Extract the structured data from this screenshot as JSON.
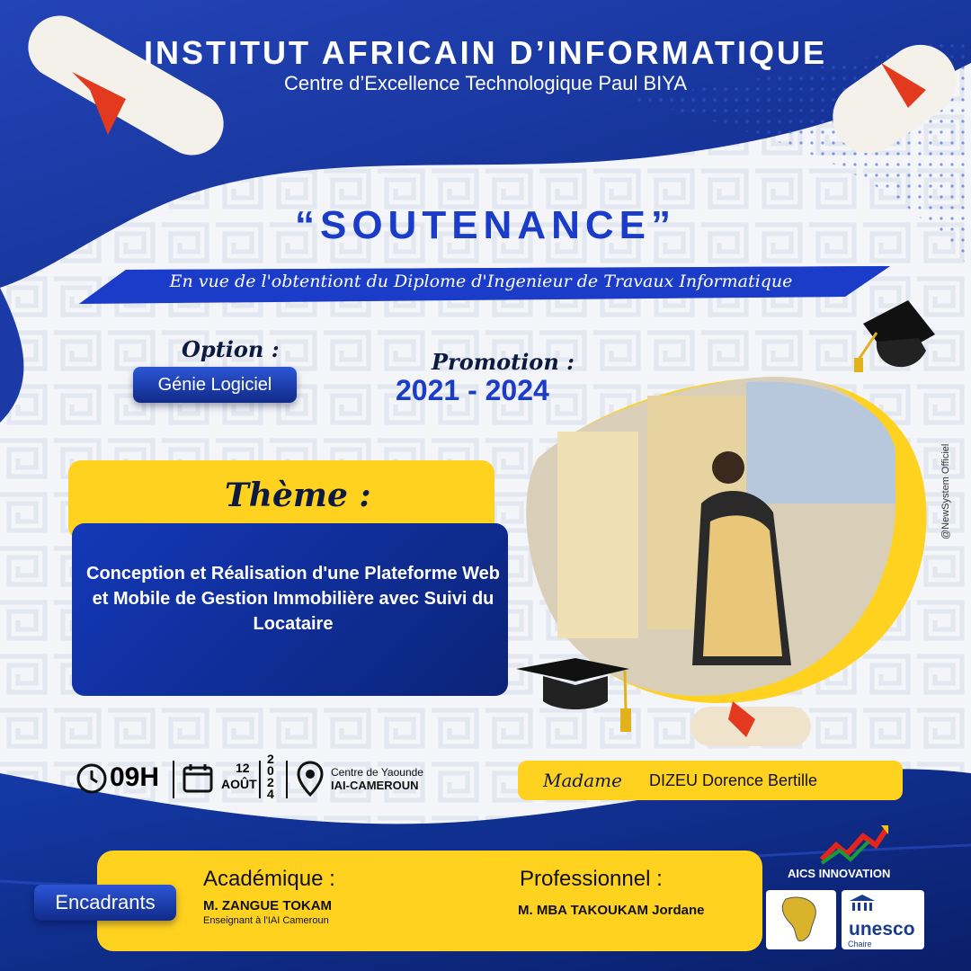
{
  "header": {
    "institute": "INSTITUT AFRICAIN D’INFORMATIQUE",
    "subtitle": "Centre d’Excellence Technologique Paul BIYA"
  },
  "event": {
    "title": "“SOUTENANCE”",
    "purpose": "En vue de l'obtentiont du Diplome d'Ingenieur de Travaux Informatique"
  },
  "option": {
    "label": "Option :",
    "value": "Génie Logiciel"
  },
  "promotion": {
    "label": "Promotion :",
    "years": "2021 - 2024"
  },
  "theme": {
    "label": "Thème :",
    "text": "Conception et Réalisation d'une Plateforme Web et Mobile de Gestion Immobilière avec Suivi du Locataire"
  },
  "schedule": {
    "time": "09H",
    "day": "12",
    "month": "AOÛT",
    "year": "2024",
    "location_line1": "Centre de Yaounde",
    "location_line2": "IAI-CAMEROUN"
  },
  "candidate": {
    "title": "Madame",
    "name": "DIZEU Dorence Bertille"
  },
  "supervisors": {
    "label": "Encadrants",
    "academic_label": "Académique :",
    "academic_name": "M. ZANGUE TOKAM",
    "academic_role": "Enseignant à l'IAI Cameroun",
    "professional_label": "Professionnel :",
    "professional_name": "M. MBA TAKOUKAM Jordane"
  },
  "credit": "@NewSystem Officiel",
  "logos": {
    "aics": "AICS INNOVATION",
    "unesco": "unesco",
    "unesco_sub": "Chaire"
  },
  "icons": [
    "diploma-scroll-icon",
    "graduation-cap-icon",
    "clock-icon",
    "calendar-icon",
    "location-pin-icon"
  ],
  "colors": {
    "blue": "#1a3cc8",
    "navy": "#0b2478",
    "yellow": "#ffd21f"
  }
}
